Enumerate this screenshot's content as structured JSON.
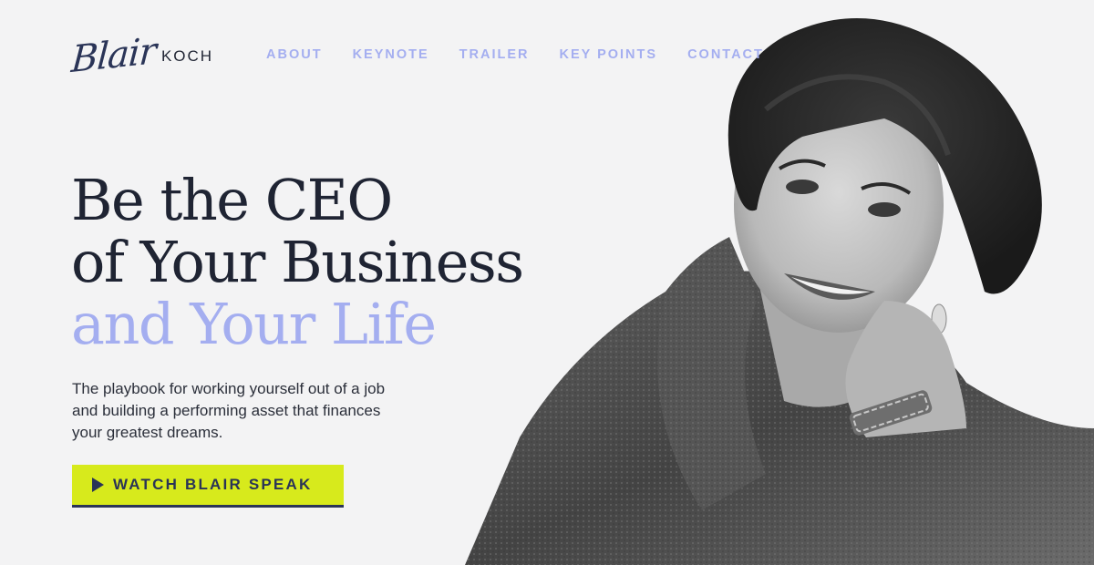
{
  "brand": {
    "script_name": "Blair",
    "word": "KOCH"
  },
  "nav": {
    "items": [
      {
        "label": "ABOUT"
      },
      {
        "label": "KEYNOTE"
      },
      {
        "label": "TRAILER"
      },
      {
        "label": "KEY POINTS"
      },
      {
        "label": "CONTACT"
      }
    ]
  },
  "hero": {
    "line1": "Be the CEO",
    "line2": "of Your Business",
    "line3": "and Your Life",
    "subtitle": "The playbook for working yourself out of a job and building a performing asset that finances your greatest dreams.",
    "cta_label": "WATCH BLAIR SPEAK"
  },
  "icons": {
    "cta_icon": "play-icon"
  },
  "colors": {
    "accent": "#a4aef0",
    "cta_background": "#d7ea1c",
    "cta_text": "#2a3457",
    "heading": "#1f2433",
    "background": "#f3f3f4"
  }
}
